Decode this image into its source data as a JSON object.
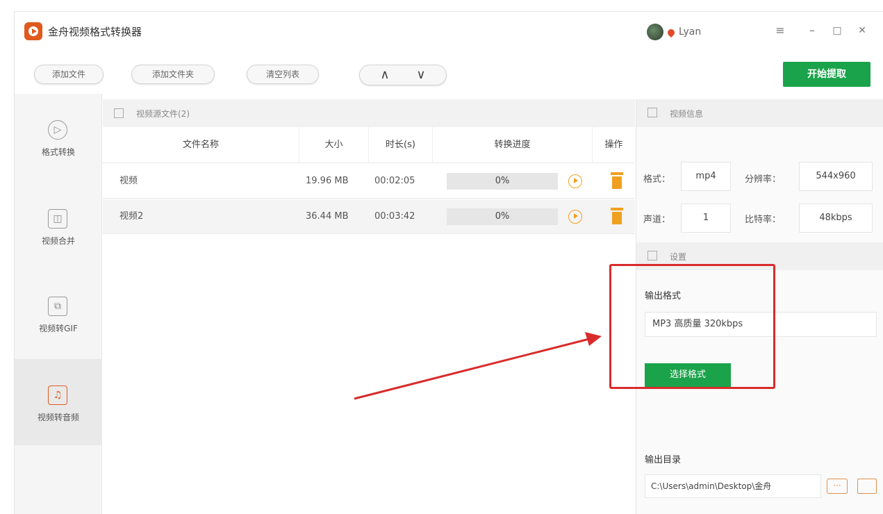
{
  "app": {
    "title": "金舟视频格式转换器",
    "username": "Lyan"
  },
  "window_controls": [
    "≡",
    "–",
    "□",
    "✕"
  ],
  "toolbar": {
    "add_file": "添加文件",
    "add_folder": "添加文件夹",
    "clear_list": "清空列表",
    "move_up": "∧",
    "move_down": "∨",
    "start": "开始提取"
  },
  "sidebar": {
    "items": [
      {
        "label": "格式转换",
        "icon": "play-circle-icon"
      },
      {
        "label": "视频合并",
        "icon": "merge-icon"
      },
      {
        "label": "视频转GIF",
        "icon": "gif-icon"
      },
      {
        "label": "视频转音频",
        "icon": "music-note-icon",
        "active": true
      }
    ]
  },
  "file_panel": {
    "header": "视频源文件(2)",
    "columns": [
      "文件名称",
      "大小",
      "时长(s)",
      "转换进度",
      "操作"
    ],
    "rows": [
      {
        "name": "视频",
        "size": "19.96 MB",
        "duration": "00:02:05",
        "progress": "0%"
      },
      {
        "name": "视频2",
        "size": "36.44 MB",
        "duration": "00:03:42",
        "progress": "0%"
      }
    ]
  },
  "video_info": {
    "header": "视频信息",
    "format_label": "格式：",
    "format_value": "mp4",
    "resolution_label": "分辨率：",
    "resolution_value": "544x960",
    "channel_label": "声道：",
    "channel_value": "1",
    "bitrate_label": "比特率：",
    "bitrate_value": "48kbps"
  },
  "settings": {
    "header": "设置",
    "output_format_label": "输出格式",
    "output_format_value": "MP3 高质量 320kbps",
    "choose_format": "选择格式",
    "output_dir_label": "输出目录",
    "output_dir_value": "C:\\Users\\admin\\Desktop\\金舟",
    "more_label": "···"
  },
  "annotation": {
    "highlight_color": "#d92b2b"
  }
}
